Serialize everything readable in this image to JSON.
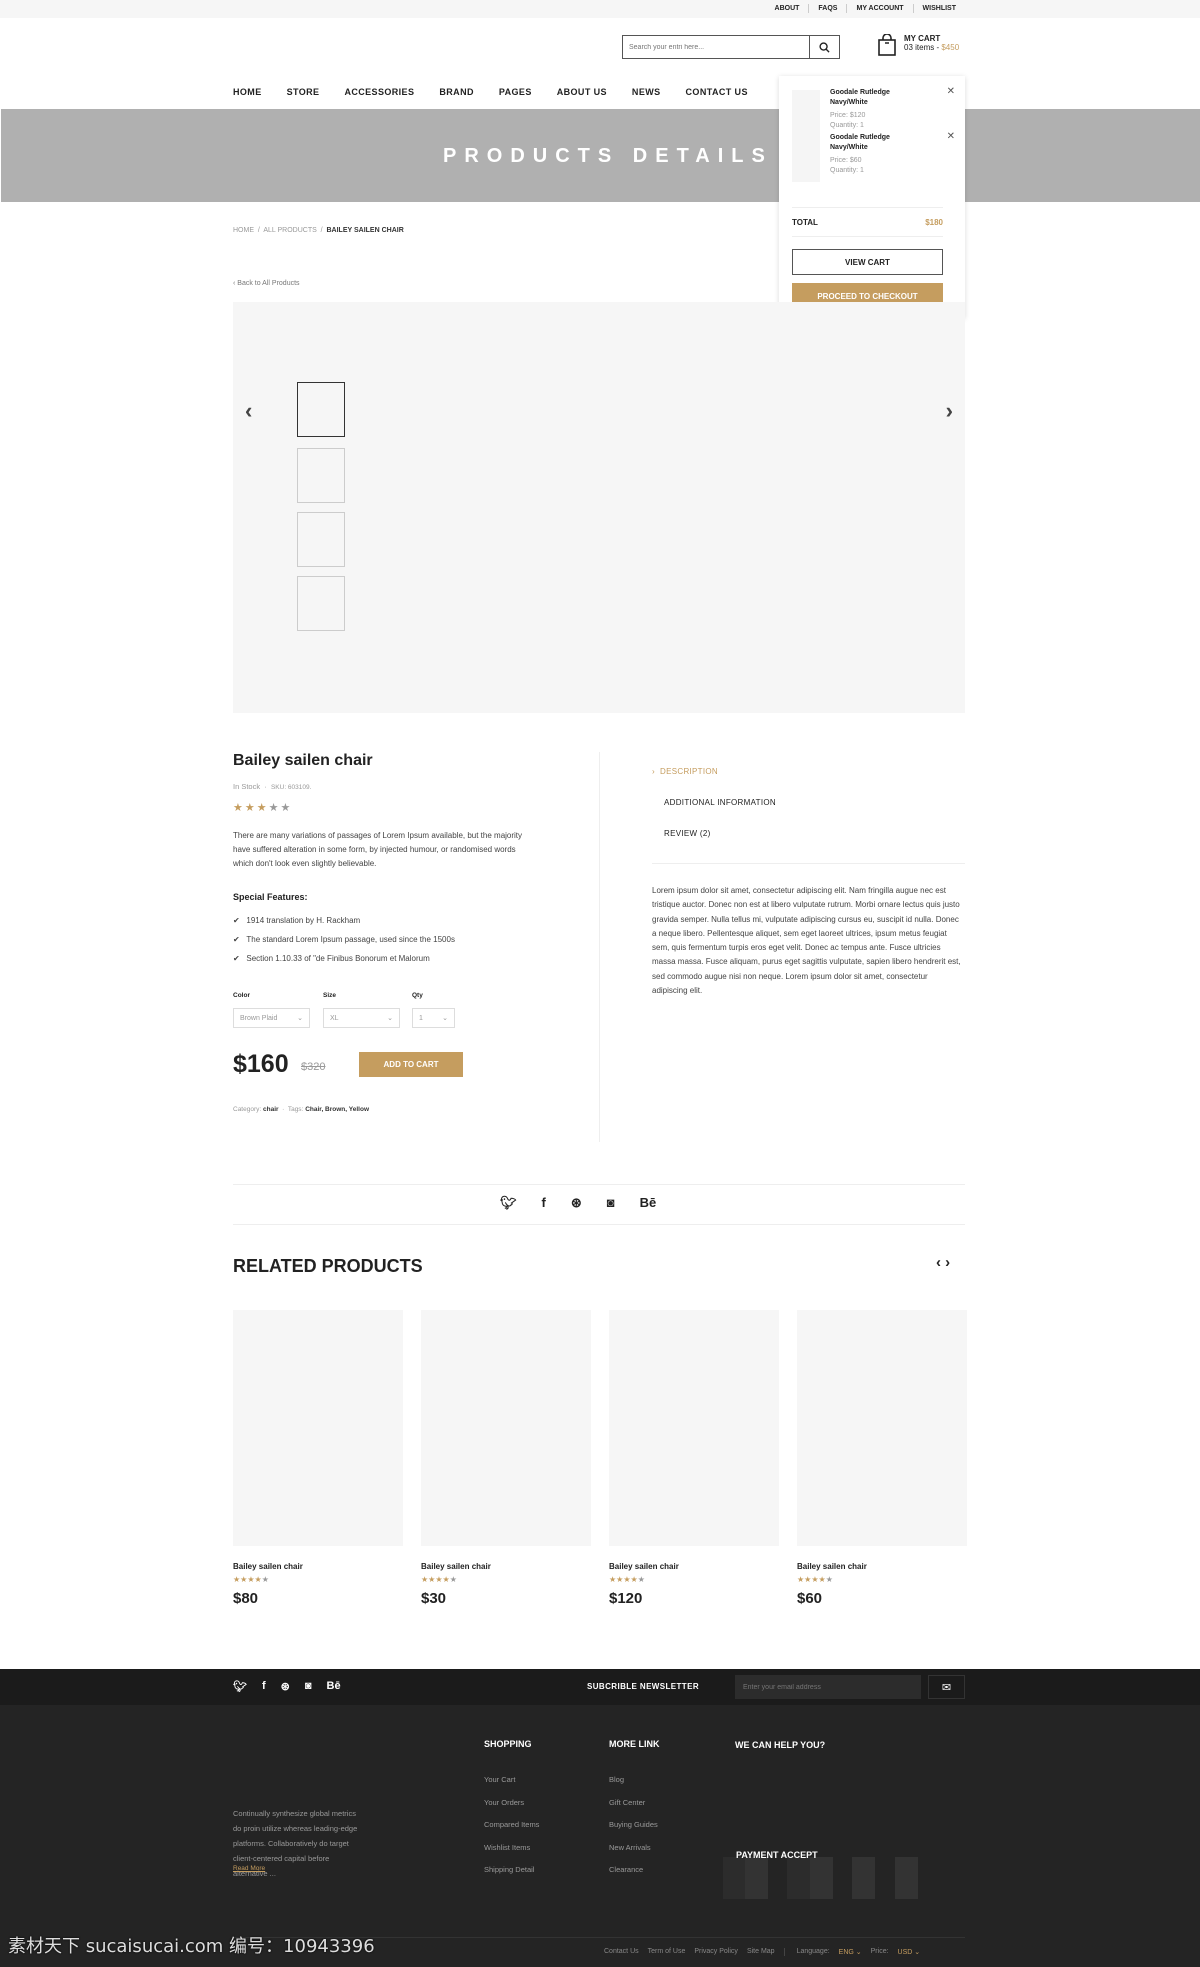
{
  "top_links": [
    "ABOUT",
    "FAQS",
    "MY ACCOUNT",
    "WISHLIST"
  ],
  "search": {
    "placeholder": "Search your entri here..."
  },
  "cart": {
    "title": "MY CART",
    "count": "03 items",
    "sep": " - ",
    "total": "$450"
  },
  "nav": [
    "HOME",
    "STORE",
    "ACCESSORIES",
    "BRAND",
    "PAGES",
    "ABOUT US",
    "NEWS",
    "CONTACT US"
  ],
  "banner": "PRODUCTS DETAILS",
  "cart_dropdown": {
    "items": [
      {
        "name": "Goodale Rutledge Navy/White",
        "price": "Price:  $120",
        "qty": "Quantity:  1"
      },
      {
        "name": "Goodale Rutledge Navy/White",
        "price": "Price:  $60",
        "qty": "Quantity:  1"
      }
    ],
    "total_label": "TOTAL",
    "total": "$180",
    "view_cart": "VIEW CART",
    "checkout": "PROCEED TO CHECKOUT"
  },
  "breadcrumb": [
    "HOME",
    "ALL PRODUCTS",
    "BAILEY SAILEN CHAIR"
  ],
  "back": "Back to All Products",
  "product": {
    "title": "Bailey sailen chair",
    "stock": "In Stock",
    "sku": "SKU: 603109.",
    "rating": 3,
    "max_rating": 5,
    "description": "There are many variations of passages of Lorem Ipsum available, but the majority have suffered alteration in some form, by injected humour, or randomised words which don't look even slightly believable.",
    "features_title": "Special Features:",
    "features": [
      "1914 translation by H. Rackham",
      "The standard Lorem Ipsum passage, used since the 1500s",
      "Section 1.10.33 of \"de Finibus Bonorum et Malorum"
    ],
    "options": [
      {
        "label": "Color",
        "value": "Brown Plaid"
      },
      {
        "label": "Size",
        "value": "XL"
      },
      {
        "label": "Qty",
        "value": "1"
      }
    ],
    "price": "$160",
    "old_price": "$320",
    "add_to_cart": "ADD TO CART",
    "category_label": "Category:",
    "category": "chair",
    "tags_label": "Tags:",
    "tags": "Chair, Brown, Yellow"
  },
  "tabs": [
    "DESCRIPTION",
    "ADDITIONAL INFORMATION",
    "REVIEW (2)"
  ],
  "tab_text": "Lorem ipsum dolor sit amet, consectetur adipiscing elit. Nam fringilla augue nec est tristique auctor. Donec non est at libero vulputate rutrum. Morbi ornare lectus quis justo gravida semper. Nulla tellus mi, vulputate adipiscing cursus eu, suscipit id nulla. Donec a neque libero. Pellentesque aliquet, sem eget laoreet ultrices, ipsum metus feugiat sem, quis fermentum turpis eros eget velit. Donec ac tempus ante. Fusce ultricies massa massa. Fusce aliquam, purus eget sagittis vulputate, sapien libero hendrerit est, sed commodo augue nisi non neque. Lorem ipsum dolor sit amet, consectetur adipiscing elit.",
  "related": {
    "title": "RELATED PRODUCTS",
    "items": [
      {
        "name": "Bailey sailen chair",
        "price": "$80",
        "rating": 4
      },
      {
        "name": "Bailey sailen chair",
        "price": "$30",
        "rating": 4
      },
      {
        "name": "Bailey sailen chair",
        "price": "$120",
        "rating": 4
      },
      {
        "name": "Bailey sailen chair",
        "price": "$60",
        "rating": 4
      }
    ]
  },
  "footer": {
    "newsletter": "SUBCRIBLE NEWSLETTER",
    "email_placeholder": "Enter your email address",
    "about": "Continually synthesize global metrics do proin utilize whereas leading-edge platforms. Collaboratively do target client-centered capital before alternative ...",
    "read_more": "Read More",
    "shopping": {
      "title": "SHOPPING",
      "links": [
        "Your Cart",
        "Your Orders",
        "Compared Items",
        "Wishlist Items",
        "Shipping Detail"
      ]
    },
    "more": {
      "title": "MORE LINK",
      "links": [
        "Blog",
        "Gift Center",
        "Buying Guides",
        "New Arrivals",
        "Clearance"
      ]
    },
    "help": "WE CAN HELP YOU?",
    "payment": "PAYMENT ACCEPT",
    "bottom_links": [
      "Contact Us",
      "Term of Use",
      "Privacy Policy",
      "Site Map"
    ],
    "language_label": "Language:",
    "language": "ENG",
    "price_label": "Price:",
    "currency": "USD"
  },
  "watermark": "素材天下 sucaisucai.com  编号：10943396",
  "colors": {
    "accent": "#c59d5f",
    "banner": "#b0b0b0",
    "footer": "#242424"
  }
}
